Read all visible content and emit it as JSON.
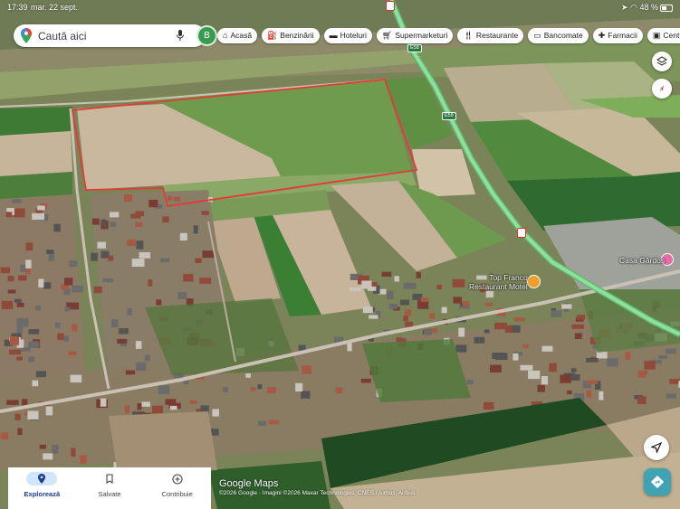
{
  "status_bar": {
    "time": "17:39",
    "date": "mar. 22 sept.",
    "battery": "48 %"
  },
  "search": {
    "placeholder": "Caută aici",
    "avatar_initial": "B"
  },
  "categories": [
    {
      "label": "Acasă",
      "icon": "home-icon"
    },
    {
      "label": "Benzinării",
      "icon": "gas-station-icon"
    },
    {
      "label": "Hoteluri",
      "icon": "bed-icon"
    },
    {
      "label": "Supermarketuri",
      "icon": "cart-icon"
    },
    {
      "label": "Restaurante",
      "icon": "fork-knife-icon"
    },
    {
      "label": "Bancomate",
      "icon": "atm-icon"
    },
    {
      "label": "Farmacii",
      "icon": "pharmacy-icon"
    },
    {
      "label": "Centre co",
      "icon": "shopping-center-icon"
    }
  ],
  "map": {
    "places": [
      {
        "name": "Top Franco\nRestaurant Motel"
      },
      {
        "name": "Casa Gârdoș"
      }
    ],
    "road_shields": [
      "E58",
      "E58"
    ],
    "brand": "Google Maps",
    "attribution": "©2026 Google · Imagini ©2026 Maxar Technologies, CNES / Airbus, Airbus"
  },
  "bottom_nav": [
    {
      "label": "Explorează",
      "active": true
    },
    {
      "label": "Salvate",
      "active": false
    },
    {
      "label": "Contribuie",
      "active": false
    }
  ],
  "colors": {
    "highway": "#7fd68e",
    "boundary": "#e53935",
    "accent": "#1a73e8",
    "directions": "#3fa3b4"
  }
}
